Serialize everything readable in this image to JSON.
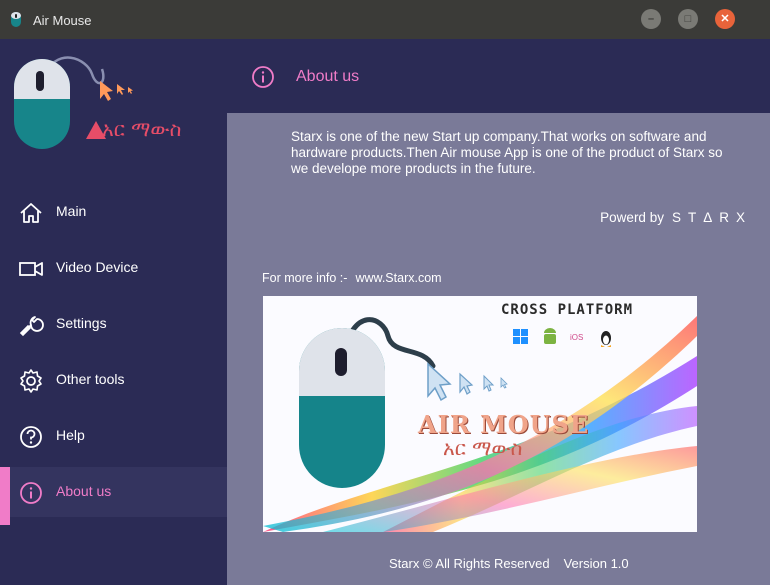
{
  "window": {
    "title": "Air Mouse",
    "icon": "mouse-icon",
    "controls": [
      "minimize-icon",
      "maximize-icon",
      "close-icon"
    ]
  },
  "logo": {
    "text": "አር ማውስ",
    "icon": "mouse-logo"
  },
  "nav": [
    {
      "label": "Main",
      "icon": "home-icon"
    },
    {
      "label": "Video Device",
      "icon": "video-icon"
    },
    {
      "label": "Settings",
      "icon": "wrench-icon"
    },
    {
      "label": "Other tools",
      "icon": "gear-icon"
    },
    {
      "label": "Help",
      "icon": "help-icon"
    },
    {
      "label": "About us",
      "icon": "info-icon",
      "active": true
    }
  ],
  "header": {
    "title": "About us",
    "icon": "info-icon"
  },
  "about": {
    "text": "Starx is one of the new Start up company.That works on software and hardware products.Then Air mouse App is one of the product of Starx so we develope more products in the future.",
    "powered_label": "Powerd by",
    "powered_brand": "STΔRX",
    "more_info_label": "For more info :-",
    "more_info_link": "www.Starx.com"
  },
  "banner": {
    "heading": "CROSS PLATFORM",
    "app_name": "AIR MOUSE",
    "app_name_local": "አር ማውስ",
    "platform_icons": [
      "windows-icon",
      "android-icon",
      "ios-icon",
      "linux-icon"
    ],
    "ios_label": "iOS"
  },
  "footer": {
    "copyright": "Starx © All Rights Reserved",
    "version": "Version 1.0"
  },
  "colors": {
    "sidebar_bg": "#2b2b55",
    "content_bg": "#7a7a98",
    "accent_pink": "#f07cc8",
    "titlebar_bg": "#3b3b38",
    "close_btn": "#e8633a",
    "mouse_teal": "#17858a"
  }
}
